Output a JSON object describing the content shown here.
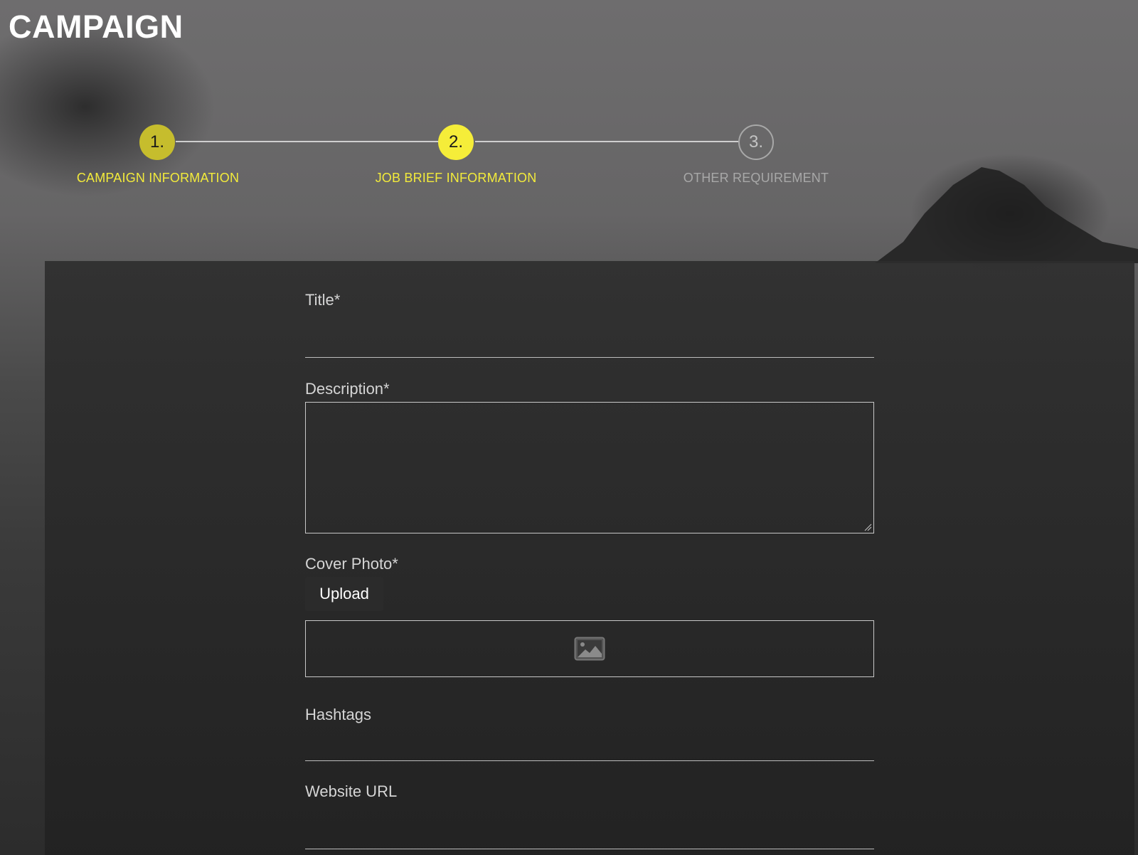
{
  "page": {
    "title": "CAMPAIGN"
  },
  "stepper": {
    "steps": [
      {
        "number": "1.",
        "label": "CAMPAIGN INFORMATION",
        "state": "done"
      },
      {
        "number": "2.",
        "label": "JOB BRIEF INFORMATION",
        "state": "active"
      },
      {
        "number": "3.",
        "label": "OTHER REQUIREMENT",
        "state": "pending"
      }
    ]
  },
  "form": {
    "title": {
      "label": "Title*",
      "value": ""
    },
    "description": {
      "label": "Description*",
      "value": ""
    },
    "cover_photo": {
      "label": "Cover Photo*",
      "upload_label": "Upload",
      "placeholder_icon": "image-icon"
    },
    "hashtags": {
      "label": "Hashtags",
      "value": ""
    },
    "website_url": {
      "label": "Website URL",
      "value": ""
    }
  },
  "colors": {
    "accent_yellow": "#f5ed39",
    "done_yellow": "#c6bd2d",
    "pending_grey": "#a8a8a8",
    "panel_dark": "#2d2d2d"
  }
}
